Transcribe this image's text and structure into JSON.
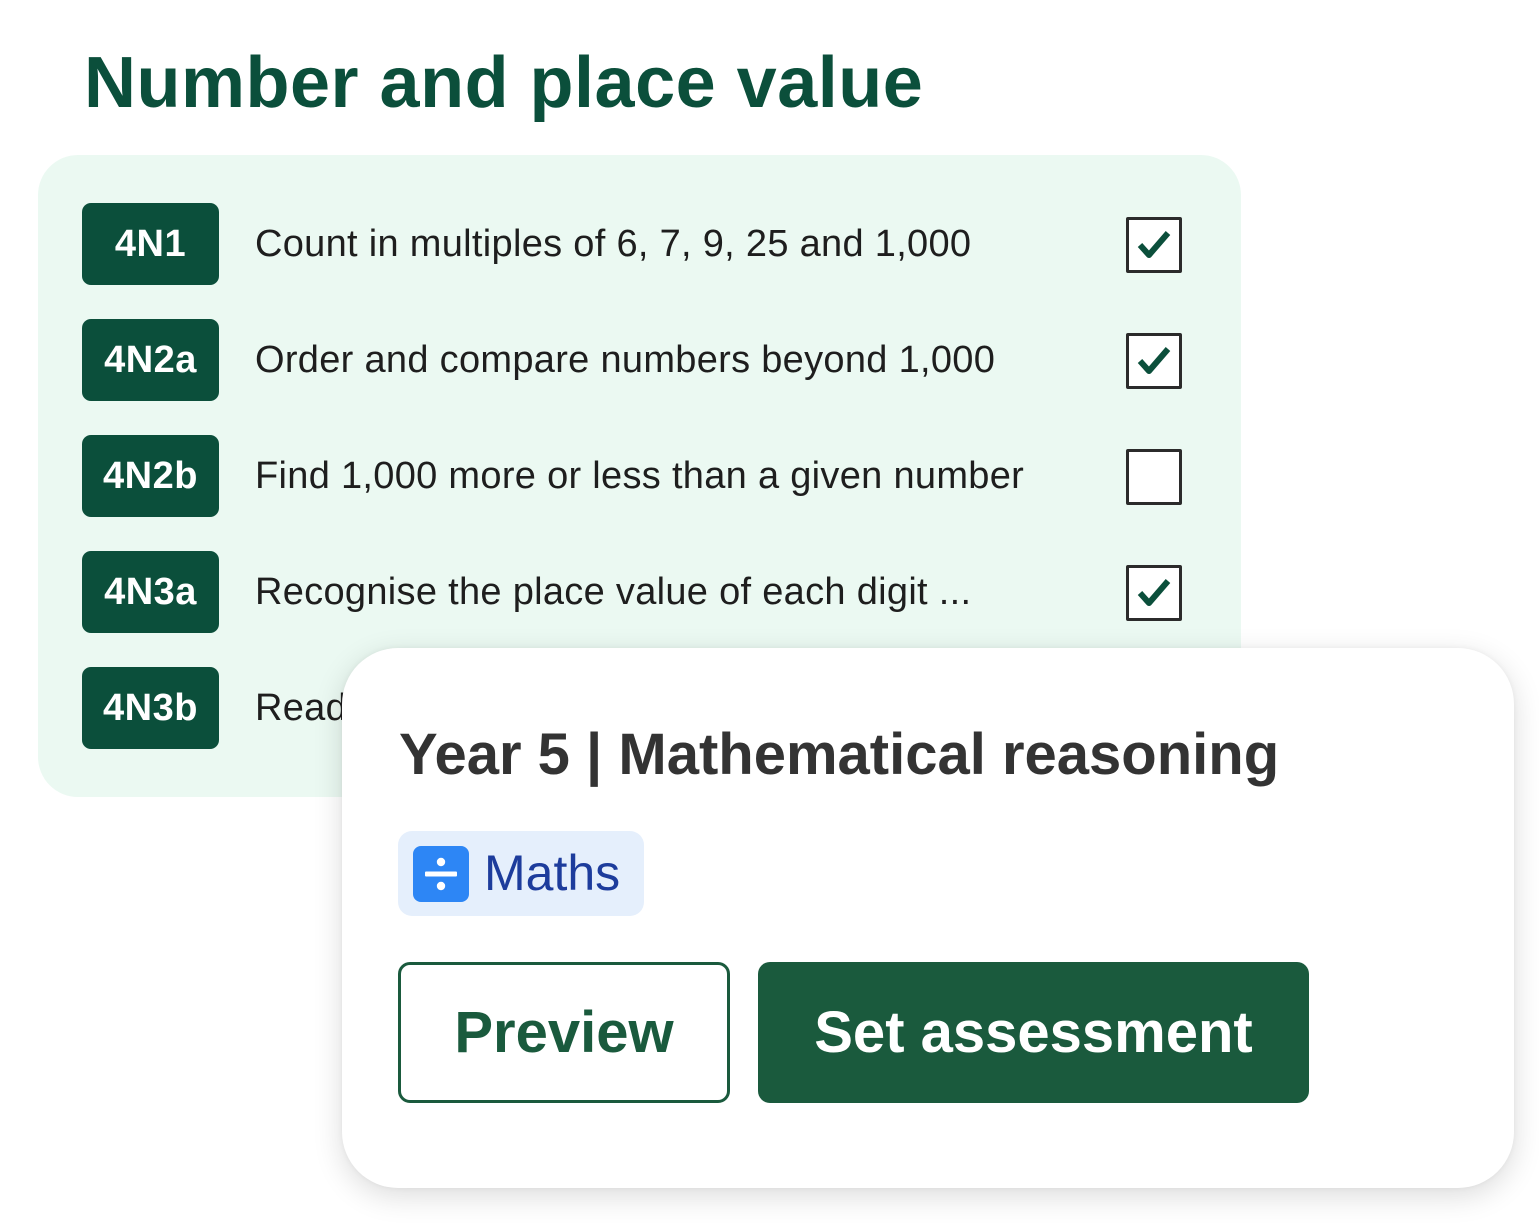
{
  "section": {
    "title": "Number and place value"
  },
  "objectives": [
    {
      "code": "4N1",
      "text": "Count in multiples of 6, 7, 9, 25 and 1,000",
      "checked": true
    },
    {
      "code": "4N2a",
      "text": "Order and compare numbers beyond 1,000",
      "checked": true
    },
    {
      "code": "4N2b",
      "text": "Find 1,000 more or less than a given number",
      "checked": false
    },
    {
      "code": "4N3a",
      "text": "Recognise the place value of each digit ...",
      "checked": true
    },
    {
      "code": "4N3b",
      "text": "Read",
      "checked": null
    }
  ],
  "card": {
    "title": "Year 5 | Mathematical reasoning",
    "subject": {
      "label": "Maths",
      "icon": "divide-icon"
    },
    "preview_label": "Preview",
    "set_label": "Set assessment"
  },
  "colors": {
    "brand_green": "#0b4f3b",
    "button_green": "#1a5a3d",
    "panel_bg": "#ebf9f2",
    "subject_blue": "#2d86f5",
    "subject_tag_bg": "#e5effc",
    "subject_text": "#1d3c9c"
  }
}
